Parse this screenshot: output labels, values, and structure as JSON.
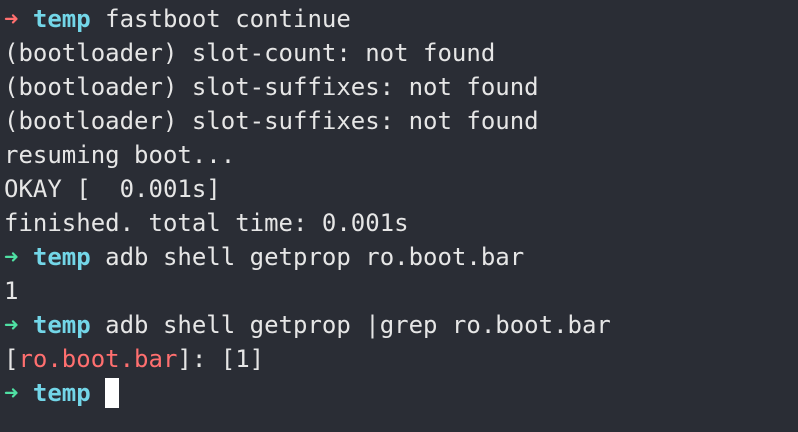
{
  "terminal": {
    "prompt_arrow": "➜",
    "prompt_dir": "temp",
    "colors": {
      "background": "#2a2d35",
      "text": "#e6e6e6",
      "arrow_error": "#ff6f6f",
      "arrow_ok": "#4fe0a3",
      "directory": "#73d6e8",
      "grep_match": "#ff6f6f"
    },
    "lines": {
      "cmd1": " fastboot continue",
      "out1": "(bootloader) slot-count: not found",
      "out2": "(bootloader) slot-suffixes: not found",
      "out3": "(bootloader) slot-suffixes: not found",
      "out4": "resuming boot...",
      "out5": "OKAY [  0.001s]",
      "out6": "finished. total time: 0.001s",
      "cmd2": " adb shell getprop ro.boot.bar",
      "out7": "1",
      "cmd3": " adb shell getprop |grep ro.boot.bar",
      "out8_pre": "[",
      "out8_match": "ro.boot.bar",
      "out8_post": "]: [1]"
    }
  }
}
